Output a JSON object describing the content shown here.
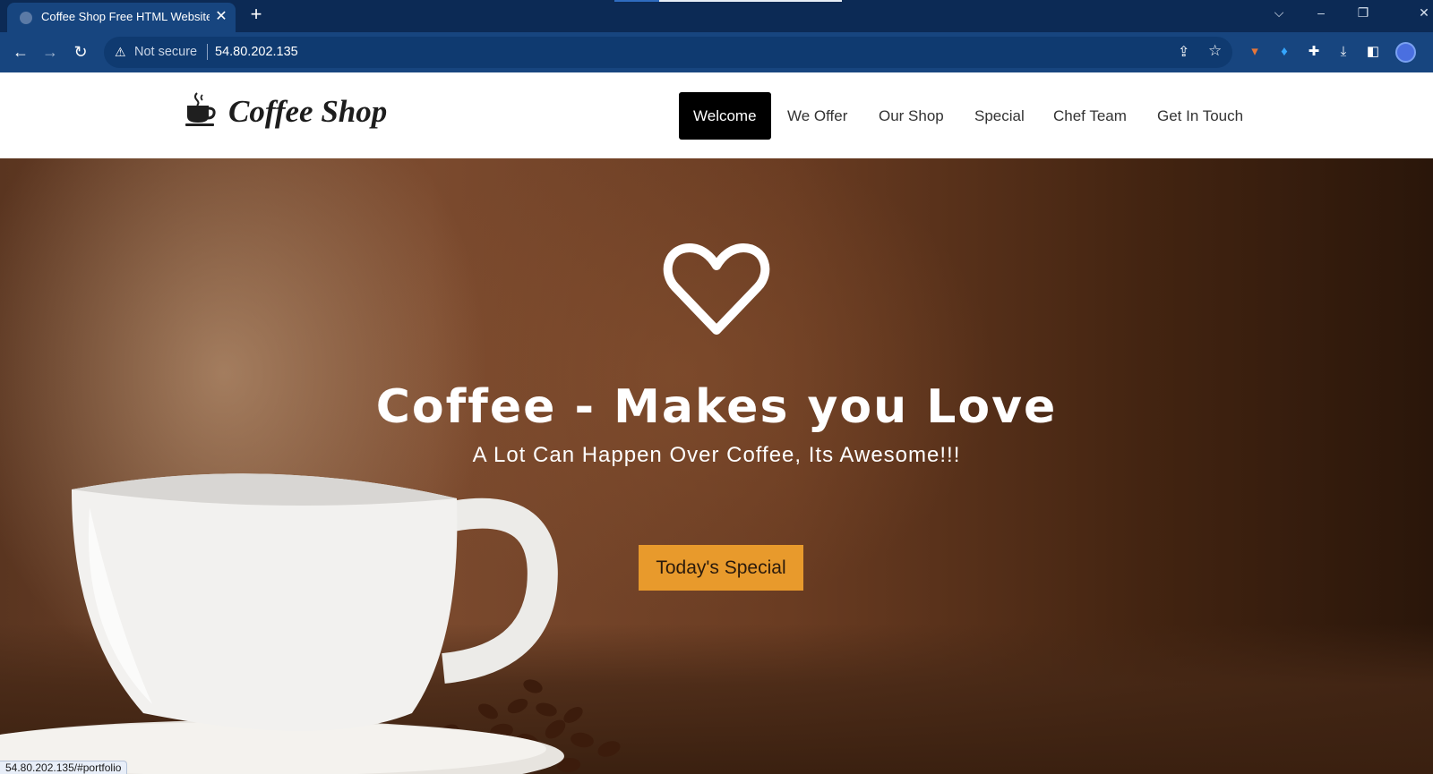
{
  "browser": {
    "tab_title": "Coffee Shop Free HTML Website",
    "tab_close": "✕",
    "new_tab": "+",
    "security_label": "Not secure",
    "url": "54.80.202.135",
    "status_url": "54.80.202.135/#portfolio",
    "icons": [
      "back-arrow",
      "forward-arrow",
      "reload",
      "warning",
      "share",
      "star",
      "coffee-extension",
      "location-pin-extension",
      "puzzle-extension",
      "download",
      "sidebar",
      "profile"
    ]
  },
  "site": {
    "logo_text": "Coffee Shop",
    "nav": [
      {
        "label": "Welcome",
        "active": true
      },
      {
        "label": "We Offer",
        "active": false
      },
      {
        "label": "Our Shop",
        "active": false
      },
      {
        "label": "Special",
        "active": false
      },
      {
        "label": "Chef Team",
        "active": false
      },
      {
        "label": "Get In Touch",
        "active": false
      }
    ]
  },
  "hero": {
    "icon": "heart-outline",
    "title": "Coffee - Makes you Love",
    "subtitle": "A Lot Can Happen Over Coffee, Its Awesome!!!",
    "cta_label": "Today's Special"
  },
  "colors": {
    "chrome_tabbar": "#0c2a55",
    "chrome_toolbar": "#17457f",
    "cta": "#e89a2c",
    "nav_active_bg": "#000000"
  }
}
